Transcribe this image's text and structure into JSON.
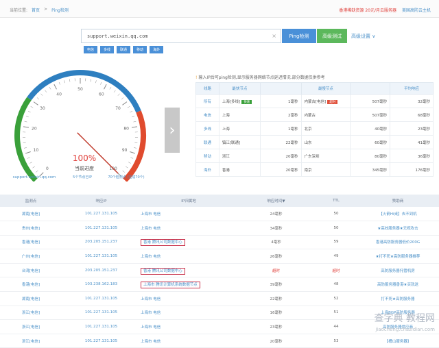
{
  "topbar": {
    "location_label": "当前位置:",
    "home": "首页",
    "sep": ">",
    "current": "Ping检测",
    "promo_red": "香港稀缺资源 20元/月云服务器",
    "promo_blue": "美国高防云主机"
  },
  "search": {
    "value": "support.weixin.qq.com",
    "clear_icon": "×",
    "ping_button": "Ping检测",
    "multi_button": "高级测试",
    "advanced_label": "高级设置 ∨",
    "isp_tags": [
      "电信",
      "多线",
      "联通",
      "移动",
      "海外"
    ]
  },
  "gauge": {
    "domain": "support.weixin.qq.com",
    "progress_percent": "100%",
    "progress_label": "当前进度",
    "nodes_done": "5个节点已IP",
    "nodes_total": "70个检测点 (完成70个)",
    "ticks": [
      "0",
      "10",
      "20",
      "30",
      "40",
      "50",
      "60",
      "70",
      "80",
      "90",
      "100"
    ],
    "needle_value": 100,
    "arc_colors": {
      "low": "#3aa03a",
      "mid": "#2e7fc0",
      "high": "#e04b2e"
    }
  },
  "summary": {
    "notice": "输入IP后可ping检测,显示服务器网络节点延迟情况.部分数据仅供参考",
    "notice_icon": "!",
    "headers": [
      "线路",
      "最快节点",
      "",
      "最慢节点",
      "",
      "平均响应"
    ],
    "rows": [
      {
        "isp": "所有",
        "fast_node": "上海[多线]",
        "fast_badge": "快速",
        "fast_ms": "1毫秒",
        "slow_node": "内蒙古[电信]",
        "slow_badge": "超时",
        "slow_ms": "507毫秒",
        "avg": "32毫秒"
      },
      {
        "isp": "电信",
        "fast_node": "上海",
        "fast_badge": "",
        "fast_ms": "2毫秒",
        "slow_node": "内蒙古",
        "slow_badge": "",
        "slow_ms": "507毫秒",
        "avg": "68毫秒"
      },
      {
        "isp": "多线",
        "fast_node": "上海",
        "fast_badge": "",
        "fast_ms": "1毫秒",
        "slow_node": "北京",
        "slow_badge": "",
        "slow_ms": "40毫秒",
        "avg": "23毫秒"
      },
      {
        "isp": "联通",
        "fast_node": "镇江[联通]",
        "fast_badge": "",
        "fast_ms": "22毫秒",
        "slow_node": "山东",
        "slow_badge": "",
        "slow_ms": "60毫秒",
        "avg": "41毫秒"
      },
      {
        "isp": "移动",
        "fast_node": "浙江",
        "fast_badge": "",
        "fast_ms": "20毫秒",
        "slow_node": "广东深圳",
        "slow_badge": "",
        "slow_ms": "80毫秒",
        "avg": "36毫秒"
      },
      {
        "isp": "海外",
        "fast_node": "香港",
        "fast_badge": "",
        "fast_ms": "20毫秒",
        "slow_node": "南京",
        "slow_badge": "",
        "slow_ms": "345毫秒",
        "avg": "176毫秒"
      }
    ]
  },
  "results": {
    "headers": [
      "监测点",
      "响应IP",
      "IP归属地",
      "响应时间▼",
      "TTL",
      "赞助商"
    ],
    "rows": [
      {
        "loc": "湖南[电信]",
        "ip": "101.227.131.105",
        "isp": "上海市 电信",
        "hl": false,
        "time": "24毫秒",
        "timeout": false,
        "ttl": "50",
        "sponsor": "【火箭Hi桌】去不到机"
      },
      {
        "loc": "贵州[电信]",
        "ip": "101.227.131.105",
        "isp": "上海市 电信",
        "hl": false,
        "time": "34毫秒",
        "timeout": false,
        "ttl": "50",
        "sponsor": "★高效服务器★无视攻击"
      },
      {
        "loc": "香港[电信]",
        "ip": "203.205.151.237",
        "isp": "香港 腾讯公司数据中心",
        "hl": true,
        "time": "4毫秒",
        "timeout": false,
        "ttl": "59",
        "sponsor": "香港高防服务器低价200G"
      },
      {
        "loc": "广州[电信]",
        "ip": "101.227.131.105",
        "isp": "上海市 电信",
        "hl": false,
        "time": "26毫秒",
        "timeout": false,
        "ttl": "49",
        "sponsor": "★打不死★高防服务器推荐"
      },
      {
        "loc": "台湾[电信]",
        "ip": "203.205.151.237",
        "isp": "香港 腾讯公司数据中心",
        "hl": true,
        "time": "超时",
        "timeout": true,
        "ttl": "超时",
        "sponsor": "高防服务器托管机房"
      },
      {
        "loc": "香港[电信]",
        "ip": "103.238.162.183",
        "isp": "上海市 腾讯计算机系统数据节点",
        "hl": true,
        "time": "39毫秒",
        "timeout": false,
        "ttl": "48",
        "sponsor": "高防服务器香港★买就送"
      },
      {
        "loc": "湖南[电信]",
        "ip": "101.227.131.105",
        "isp": "上海市 电信",
        "hl": false,
        "time": "22毫秒",
        "timeout": false,
        "ttl": "52",
        "sponsor": "打不死★高防服务器"
      },
      {
        "loc": "浙江[电信]",
        "ip": "101.227.131.105",
        "isp": "上海市 电信",
        "hl": false,
        "time": "16毫秒",
        "timeout": false,
        "ttl": "51",
        "sponsor": "上海BGP高防服务器"
      },
      {
        "loc": "浙江[电信]",
        "ip": "101.227.131.105",
        "isp": "上海市 电信",
        "hl": false,
        "time": "23毫秒",
        "timeout": false,
        "ttl": "44",
        "sponsor": "高防服务器供应商"
      },
      {
        "loc": "浙江[电信]",
        "ip": "101.227.131.105",
        "isp": "上海市 电信",
        "hl": false,
        "time": "20毫秒",
        "timeout": false,
        "ttl": "53",
        "sponsor": "【槽山服务器】"
      }
    ]
  },
  "watermark": {
    "main": "查字典 教程网",
    "url": "jiaocheng.chazidian.com"
  }
}
